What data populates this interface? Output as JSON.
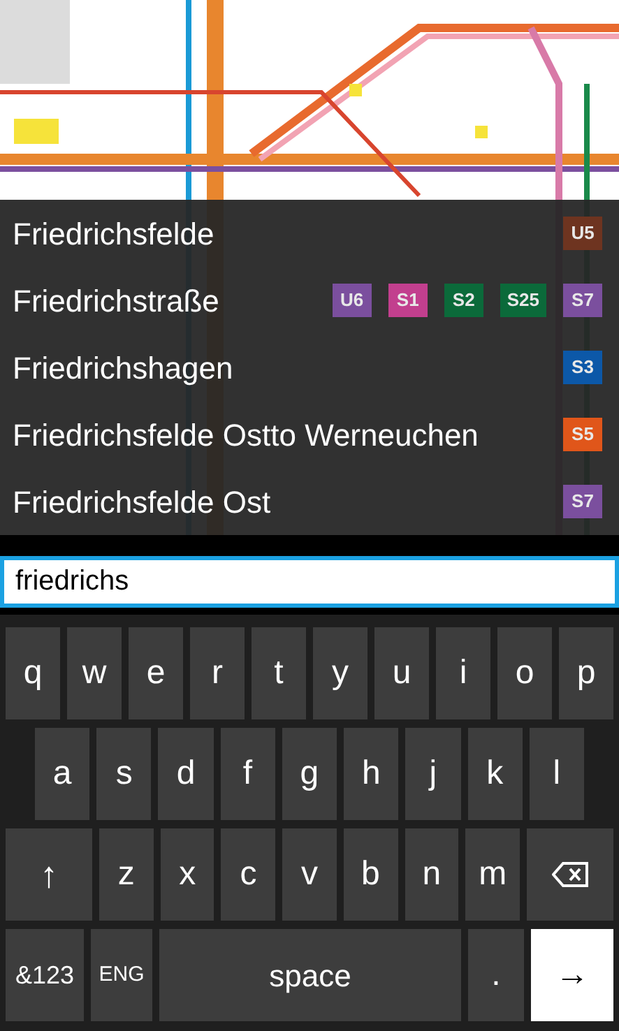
{
  "map": {
    "kind": "picture"
  },
  "suggestions": [
    {
      "name": "Friedrichsfelde",
      "lines": [
        {
          "label": "U5",
          "color": "#6e3420"
        }
      ]
    },
    {
      "name": "Friedrichstraße",
      "lines": [
        {
          "label": "U6",
          "color": "#7b4f9e"
        },
        {
          "label": "S1",
          "color": "#c23f8e"
        },
        {
          "label": "S2",
          "color": "#0b6a3a"
        },
        {
          "label": "S25",
          "color": "#0b6a3a"
        },
        {
          "label": "S7",
          "color": "#7b4f9e"
        }
      ]
    },
    {
      "name": "Friedrichshagen",
      "lines": [
        {
          "label": "S3",
          "color": "#0c58a8"
        }
      ]
    },
    {
      "name": "Friedrichsfelde Ostto Werneuchen",
      "lines": [
        {
          "label": "S5",
          "color": "#e0561a"
        }
      ]
    },
    {
      "name": "Friedrichsfelde Ost",
      "lines": [
        {
          "label": "S7",
          "color": "#7b4f9e"
        }
      ]
    }
  ],
  "search": {
    "value": "friedrichs"
  },
  "keyboard": [
    [
      {
        "kind": "letter",
        "label": "q"
      },
      {
        "kind": "letter",
        "label": "w"
      },
      {
        "kind": "letter",
        "label": "e"
      },
      {
        "kind": "letter",
        "label": "r"
      },
      {
        "kind": "letter",
        "label": "t"
      },
      {
        "kind": "letter",
        "label": "y"
      },
      {
        "kind": "letter",
        "label": "u"
      },
      {
        "kind": "letter",
        "label": "i"
      },
      {
        "kind": "letter",
        "label": "o"
      },
      {
        "kind": "letter",
        "label": "p"
      }
    ],
    [
      {
        "kind": "letter",
        "label": "a"
      },
      {
        "kind": "letter",
        "label": "s"
      },
      {
        "kind": "letter",
        "label": "d"
      },
      {
        "kind": "letter",
        "label": "f"
      },
      {
        "kind": "letter",
        "label": "g"
      },
      {
        "kind": "letter",
        "label": "h"
      },
      {
        "kind": "letter",
        "label": "j"
      },
      {
        "kind": "letter",
        "label": "k"
      },
      {
        "kind": "letter",
        "label": "l"
      }
    ],
    [
      {
        "kind": "shift",
        "label": "↑"
      },
      {
        "kind": "letter",
        "label": "z"
      },
      {
        "kind": "letter",
        "label": "x"
      },
      {
        "kind": "letter",
        "label": "c"
      },
      {
        "kind": "letter",
        "label": "v"
      },
      {
        "kind": "letter",
        "label": "b"
      },
      {
        "kind": "letter",
        "label": "n"
      },
      {
        "kind": "letter",
        "label": "m"
      },
      {
        "kind": "backspace"
      }
    ],
    [
      {
        "kind": "symbols",
        "label": "&123"
      },
      {
        "kind": "language",
        "label": "ENG"
      },
      {
        "kind": "space",
        "label": "space"
      },
      {
        "kind": "letter",
        "label": "."
      },
      {
        "kind": "enter",
        "label": "→"
      }
    ]
  ]
}
